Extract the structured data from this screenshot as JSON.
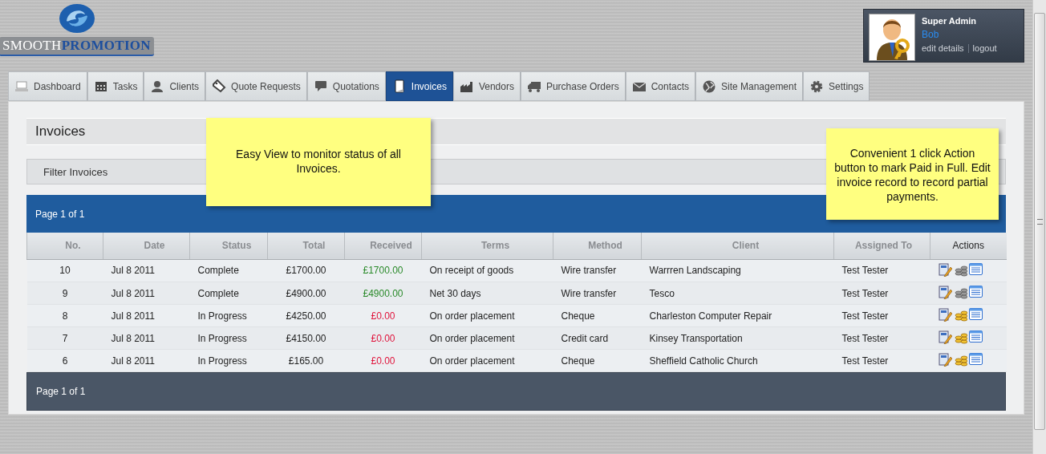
{
  "logo": {
    "text_light": "SMOOTH",
    "text_dark": "PROMOTION"
  },
  "user": {
    "role": "Super Admin",
    "name": "Bob",
    "links": [
      "edit details",
      "logout"
    ]
  },
  "tabs": [
    {
      "label": "Dashboard",
      "selected": false
    },
    {
      "label": "Tasks",
      "selected": false
    },
    {
      "label": "Clients",
      "selected": false
    },
    {
      "label": "Quote Requests",
      "selected": false
    },
    {
      "label": "Quotations",
      "selected": false
    },
    {
      "label": "Invoices",
      "selected": true
    },
    {
      "label": "Vendors",
      "selected": false
    },
    {
      "label": "Purchase Orders",
      "selected": false
    },
    {
      "label": "Contacts",
      "selected": false
    },
    {
      "label": "Site Management",
      "selected": false
    },
    {
      "label": "Settings",
      "selected": false
    }
  ],
  "page_title": "Invoices",
  "filter_label": "Filter Invoices",
  "pager_top": "Page 1 of 1",
  "table": {
    "columns": [
      "No.",
      "Date",
      "Status",
      "Total",
      "Received",
      "Terms",
      "Method",
      "Client",
      "Assigned To",
      "Actions"
    ],
    "rows": [
      {
        "no": "10",
        "date": "Jul 8 2011",
        "status": "Complete",
        "total": "£1700.00",
        "received": "£1700.00",
        "paid": true,
        "terms": "On receipt of goods",
        "method": "Wire transfer",
        "client": "Warrren Landscaping",
        "assigned_to": "Test Tester"
      },
      {
        "no": "9",
        "date": "Jul 8 2011",
        "status": "Complete",
        "total": "£4900.00",
        "received": "£4900.00",
        "paid": true,
        "terms": "Net 30 days",
        "method": "Wire transfer",
        "client": "Tesco",
        "assigned_to": "Test Tester"
      },
      {
        "no": "8",
        "date": "Jul 8 2011",
        "status": "In Progress",
        "total": "£4250.00",
        "received": "£0.00",
        "paid": false,
        "terms": "On order placement",
        "method": "Cheque",
        "client": "Charleston Computer Repair",
        "assigned_to": "Test Tester"
      },
      {
        "no": "7",
        "date": "Jul 8 2011",
        "status": "In Progress",
        "total": "£4150.00",
        "received": "£0.00",
        "paid": false,
        "terms": "On order placement",
        "method": "Credit card",
        "client": "Kinsey Transportation",
        "assigned_to": "Test Tester"
      },
      {
        "no": "6",
        "date": "Jul 8 2011",
        "status": "In Progress",
        "total": "£165.00",
        "received": "£0.00",
        "paid": false,
        "terms": "On order placement",
        "method": "Cheque",
        "client": "Sheffield Catholic Church",
        "assigned_to": "Test Tester"
      }
    ]
  },
  "pager_bottom": "Page 1 of 1",
  "notes": [
    "Easy View to monitor status of all Invoices.",
    "Convenient 1 click Action button to mark Paid in Full. Edit invoice record to record partial payments."
  ]
}
